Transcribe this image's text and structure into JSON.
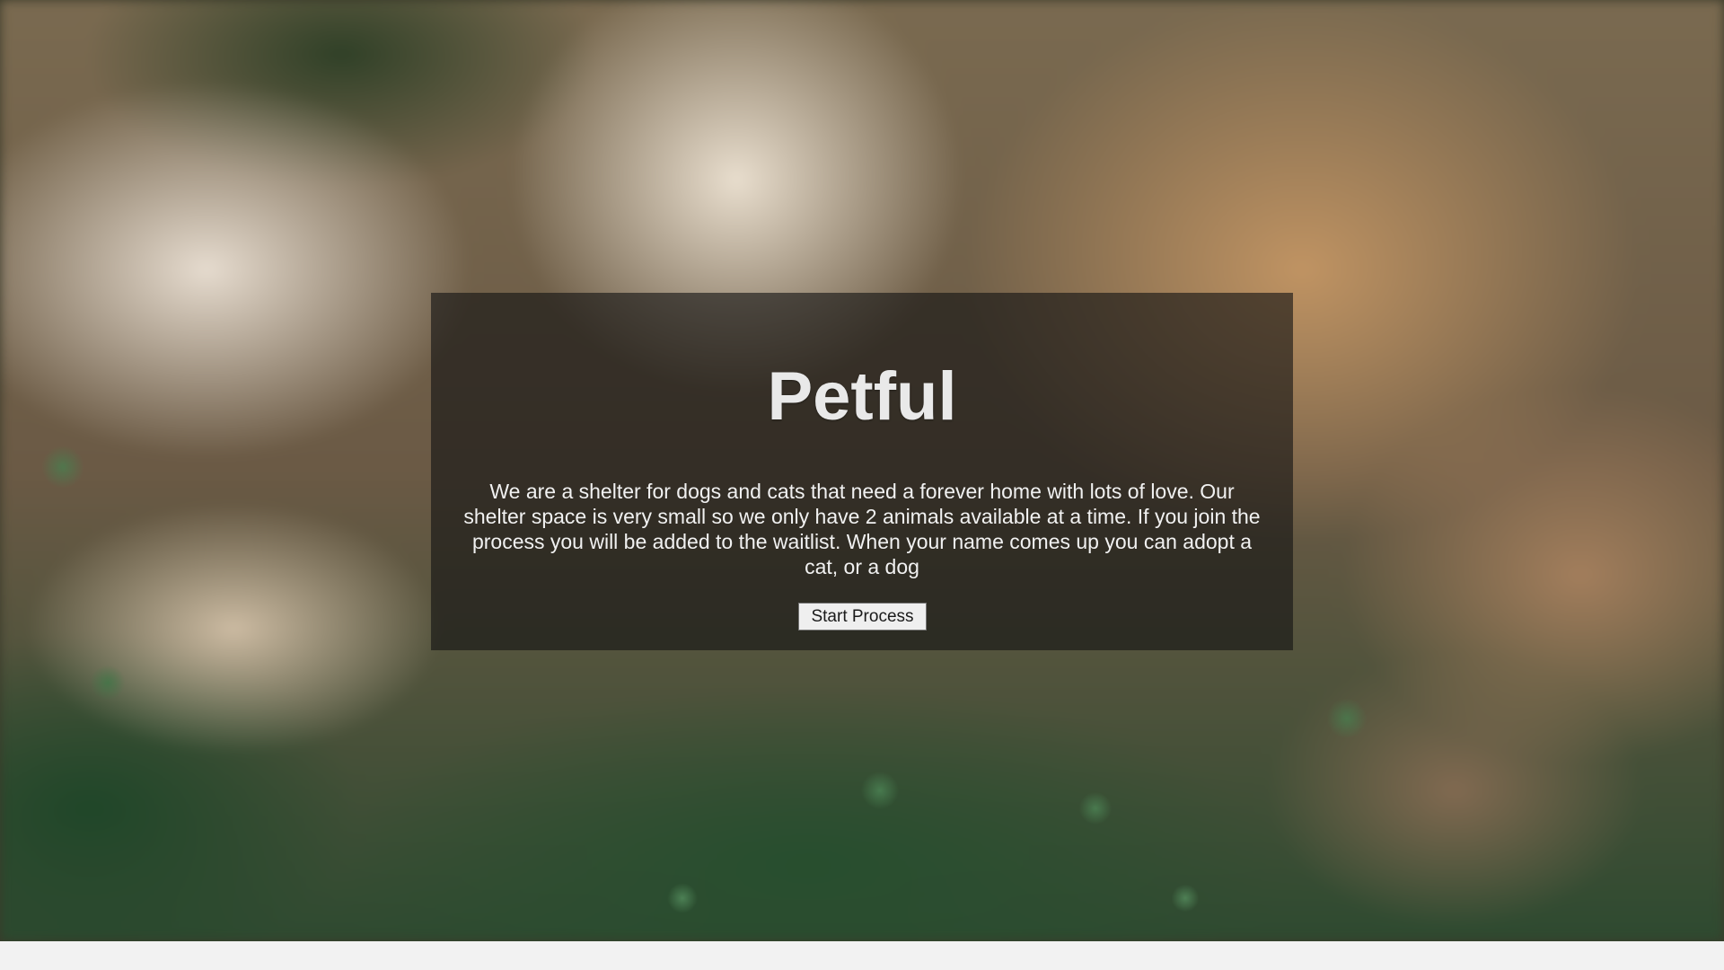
{
  "hero": {
    "title": "Petful",
    "description": "We are a shelter for dogs and cats that need a forever home with lots of love. Our shelter space is very small so we only have 2 animals available at a time. If you join the process you will be added to the waitlist. When your name comes up you can adopt a cat, or a dog",
    "start_button_label": "Start Process"
  },
  "colors": {
    "overlay": "rgba(20,20,20,0.62)",
    "title_text": "#e9e9e9",
    "body_text": "#f1f1f1",
    "page_background": "#f2f2f2"
  }
}
